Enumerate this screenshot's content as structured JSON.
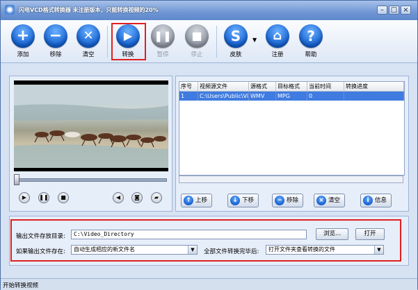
{
  "window": {
    "title": "闪电VCD格式转换器  未注册版本，只能转换视频的20%",
    "controls": [
      {
        "name": "minimize",
        "glyph": "–"
      },
      {
        "name": "maximize",
        "glyph": "□"
      },
      {
        "name": "close",
        "glyph": "×"
      }
    ]
  },
  "toolbar": {
    "add": "添加",
    "remove": "移除",
    "clear": "清空",
    "convert": "转换",
    "pause": "暂停",
    "stop": "停止",
    "skin": "皮肤",
    "register": "注册",
    "help": "帮助"
  },
  "player": {
    "play_icon": "play-icon",
    "pause_icon": "pause-icon",
    "stop_icon": "stop-icon",
    "volume_icon": "volume-icon",
    "snapshot_icon": "camera-icon",
    "folder_icon": "folder-icon"
  },
  "file_table": {
    "columns": [
      "序号",
      "视频源文件",
      "源格式",
      "目标格式",
      "当前时间",
      "转换进度"
    ],
    "rows": [
      {
        "index": "1",
        "source": "C:\\Users\\Public\\Vide...",
        "src_format": "WMV",
        "dst_format": "MPG",
        "time": "0",
        "progress": ""
      }
    ]
  },
  "list_buttons": {
    "up": "上移",
    "down": "下移",
    "remove": "移除",
    "clear": "清空",
    "info": "信息"
  },
  "output": {
    "dir_label": "输出文件存放目录:",
    "dir_value": "C:\\Video_Directory",
    "browse": "浏览...",
    "open": "打开",
    "exists_label": "如果输出文件存在:",
    "exists_value": "自动生成相应的新文件名",
    "after_label": "全部文件转换完毕后:",
    "after_value": "打开文件夹查看转换的文件"
  },
  "status": {
    "text": "开始转换视频"
  },
  "colors": {
    "accent": "#1360d1",
    "highlight_box": "#e02020",
    "selected_row": "#3f7be0"
  }
}
